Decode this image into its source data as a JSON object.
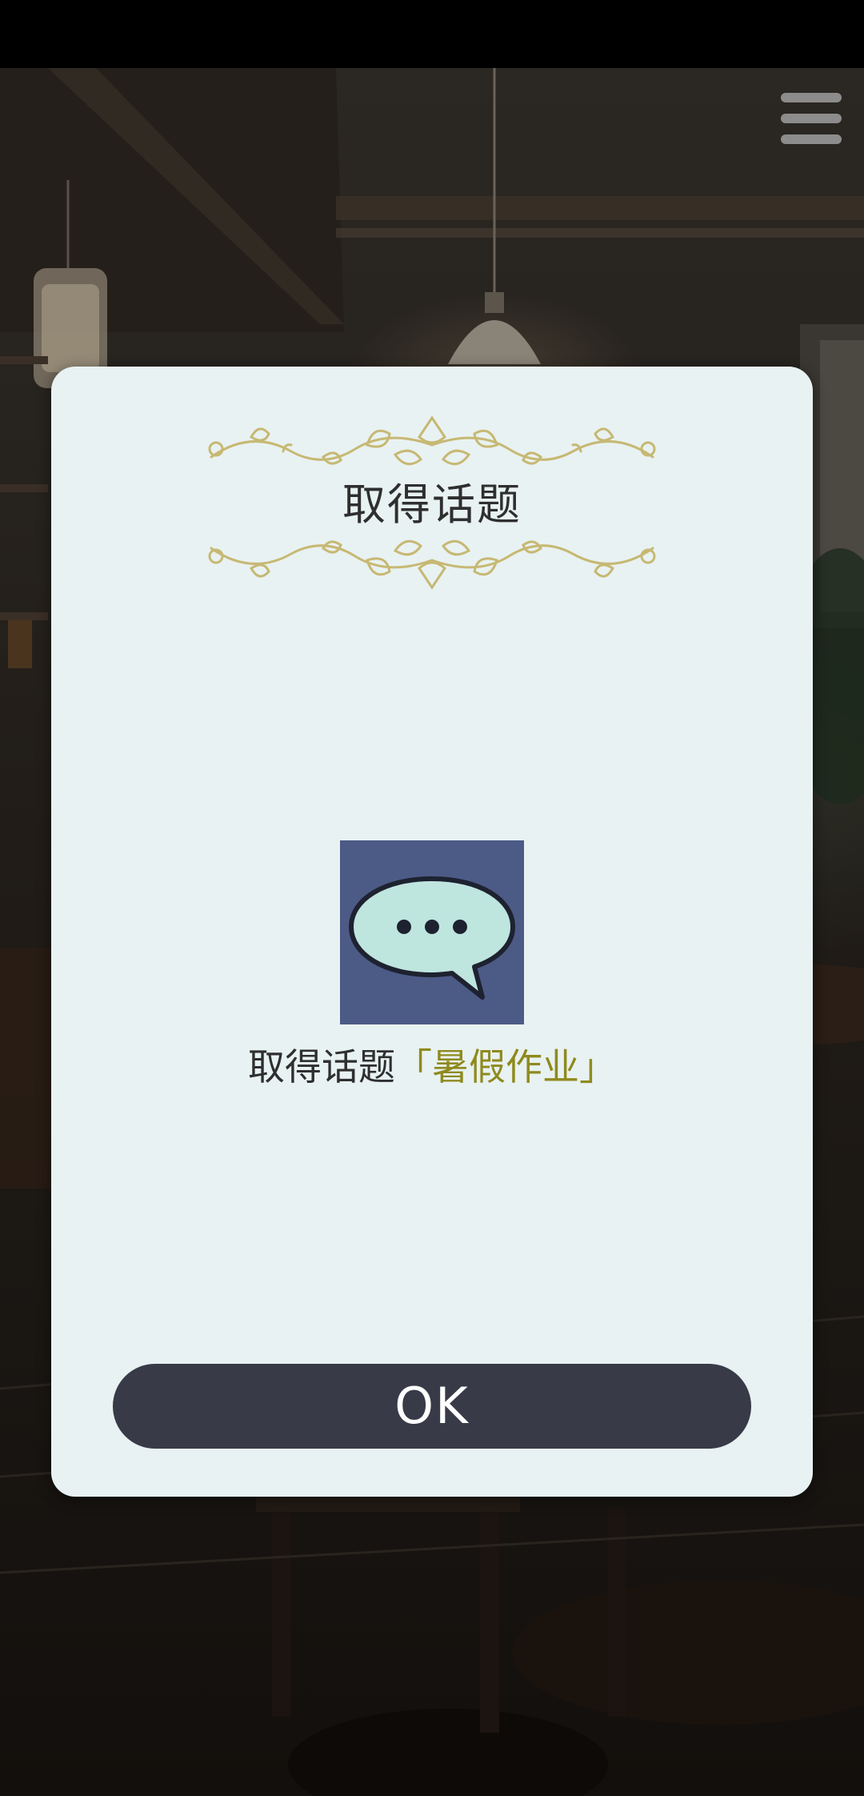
{
  "screen": {
    "background": "cafe-interior-scene"
  },
  "toolbar": {
    "menu_icon": "hamburger-menu-icon"
  },
  "dialog": {
    "title": "取得话题",
    "ornament_icon": "vine-ornament-icon",
    "topic_icon": "speech-bubble-icon",
    "message_prefix": "取得话题",
    "topic_name": "「暑假作业」",
    "ok_label": "OK",
    "colors": {
      "panel": "#e8f2f2",
      "ornament": "#c7b873",
      "icon_bg": "#4c5a86",
      "bubble": "#bfe5df",
      "topic_highlight": "#8f8a1e",
      "button": "#383a48"
    }
  }
}
